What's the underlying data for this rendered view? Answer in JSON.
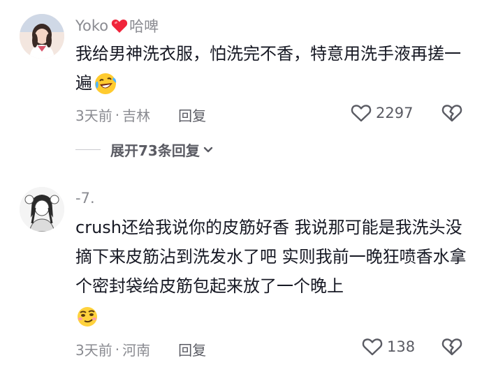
{
  "comments": [
    {
      "username": "Yoko",
      "name_suffix": "哈啤",
      "name_heart_icon": "red-heart-icon",
      "text": "我给男神洗衣服，怕洗完不香，特意用洗手液再搓一遍",
      "emoji": "laughing-crying-emoji",
      "time": "3天前",
      "location": "吉林",
      "reply_label": "回复",
      "likes": "2297",
      "expand_label": "展开73条回复"
    },
    {
      "username": "-7.",
      "text": "crush还给我说你的皮筋好香 我说那可能是我洗头没摘下来皮筋沾到洗发水了吧 实则我前一晚狂喷香水拿个密封袋给皮筋包起来放了一个晚上",
      "emoji": "smug-face-emoji",
      "time": "3天前",
      "location": "河南",
      "reply_label": "回复",
      "likes": "138"
    }
  ],
  "meta_separator": "·",
  "colors": {
    "name": "#8a8b91",
    "text": "#161823",
    "heart": "#fe2c55"
  }
}
